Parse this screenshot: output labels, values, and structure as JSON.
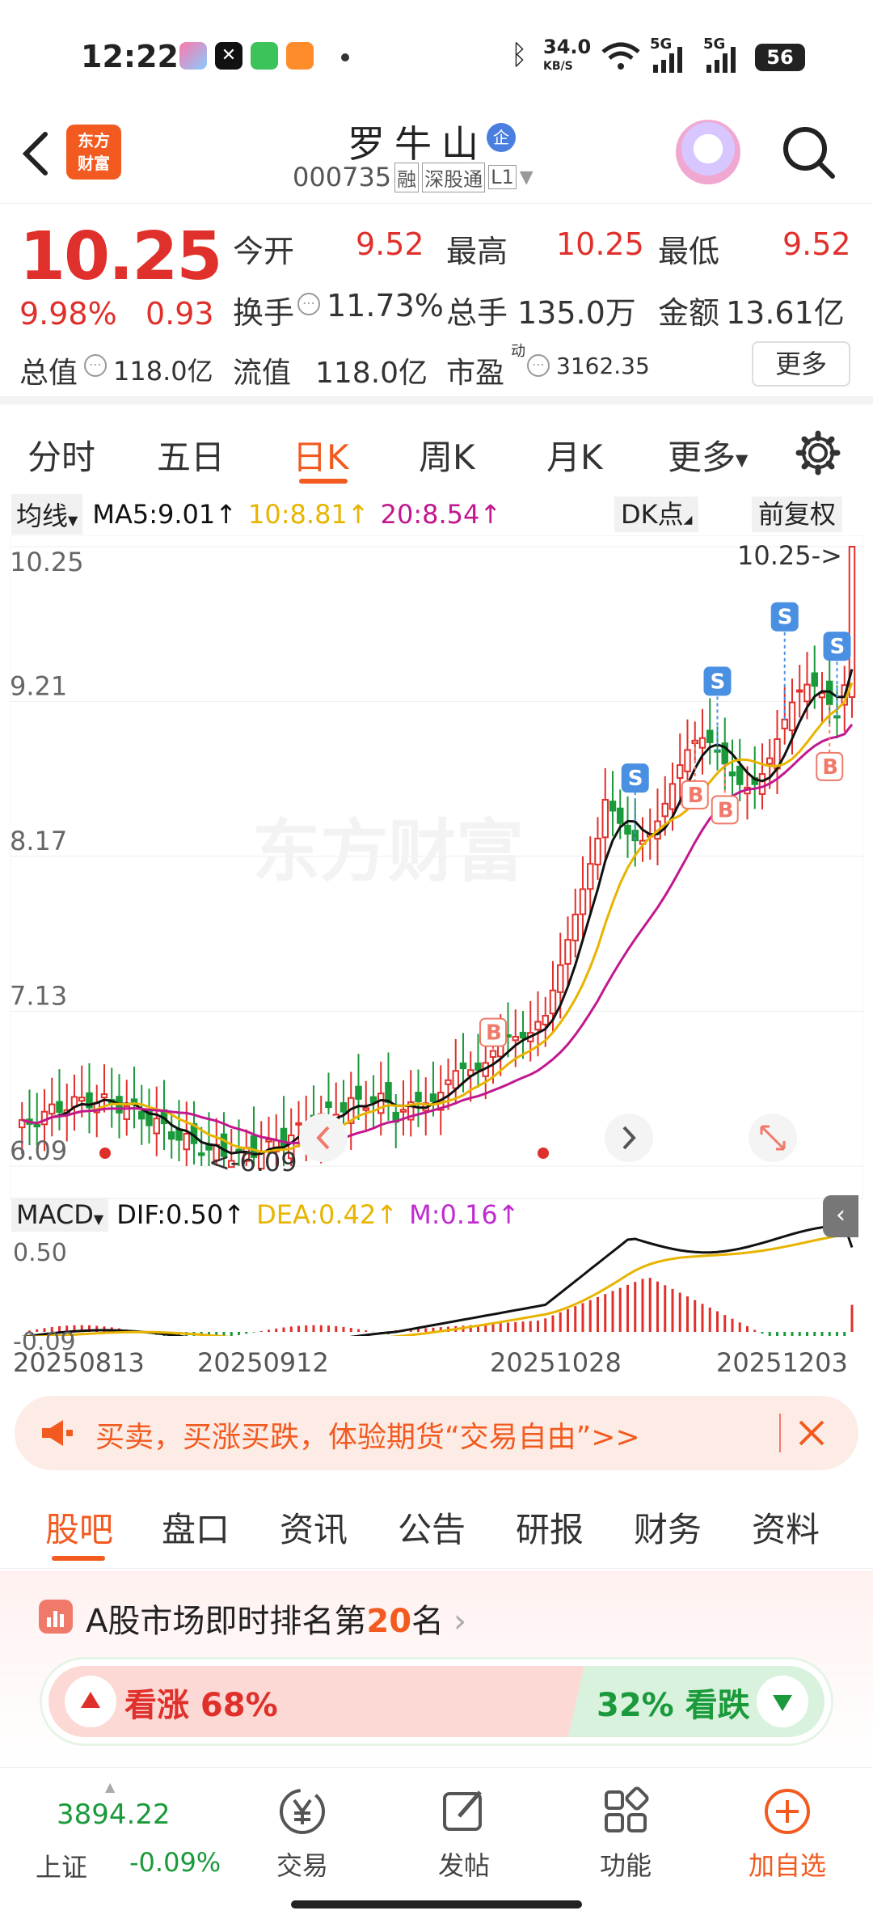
{
  "status_bar": {
    "time": "12:22",
    "net_speed_value": "34.0",
    "net_speed_unit": "KB/S",
    "signal1": "5G",
    "signal2": "5G",
    "battery": "56"
  },
  "header": {
    "logo_line1": "东方",
    "logo_line2": "财富",
    "stock_name": "罗牛山",
    "enterprise_badge": "企",
    "stock_code": "000735",
    "tags": [
      "融",
      "深股通",
      "L1"
    ]
  },
  "quote": {
    "price": "10.25",
    "change_pct": "9.98%",
    "change_amt": "0.93",
    "open_label": "今开",
    "open": "9.52",
    "high_label": "最高",
    "high": "10.25",
    "low_label": "最低",
    "low": "9.52",
    "turnover_label": "换手",
    "turnover": "11.73%",
    "volume_label": "总手",
    "volume": "135.0万",
    "amount_label": "金额",
    "amount": "13.61亿",
    "mktcap_label": "总值",
    "mktcap": "118.0亿",
    "float_label": "流值",
    "float_cap": "118.0亿",
    "pe_label": "市盈",
    "pe_sup": "动",
    "pe": "3162.35",
    "more_label": "更多"
  },
  "period_tabs": [
    "分时",
    "五日",
    "日K",
    "周K",
    "月K",
    "更多"
  ],
  "active_period": "日K",
  "kline": {
    "ma_selector": "均线",
    "ma5": "MA5:9.01↑",
    "ma10": "10:8.81↑",
    "ma20": "20:8.54↑",
    "dk_label": "DK点",
    "adjust_label": "前复权",
    "y_labels": [
      "10.25",
      "9.21",
      "8.17",
      "7.13",
      "6.09"
    ],
    "max_label": "10.25->",
    "min_label": "<-6.09",
    "watermark": "东方财富",
    "signal_s": "S",
    "signal_b": "B"
  },
  "macd": {
    "selector": "MACD",
    "dif": "DIF:0.50↑",
    "dea": "DEA:0.42↑",
    "m": "M:0.16↑",
    "y_top": "0.50",
    "y_bottom": "-0.09"
  },
  "x_dates": [
    "20250813",
    "20250912",
    "20251028",
    "20251203"
  ],
  "banner": {
    "text": "买卖，买涨买跌，体验期货“交易自由”>>"
  },
  "section_tabs": [
    "股吧",
    "盘口",
    "资讯",
    "公告",
    "研报",
    "财务",
    "资料"
  ],
  "active_section": "股吧",
  "ranking": {
    "prefix": "A股市场即时排名第",
    "rank": "20",
    "suffix": "名",
    "up_label": "看涨 68%",
    "down_label": "32% 看跌",
    "up_pct": 68
  },
  "bottom_bar": {
    "index_value": "3894.22",
    "index_name": "上证",
    "index_change": "-0.09%",
    "items": [
      "交易",
      "发帖",
      "功能",
      "加自选"
    ]
  },
  "colors": {
    "up": "#e0302b",
    "down": "#1a9a3a",
    "ma5": "#111111",
    "ma10": "#e8b400",
    "ma20": "#c2188f",
    "accent": "#ff6a00",
    "signal_s": "#4a90e2",
    "signal_b": "#f07a6a"
  }
}
